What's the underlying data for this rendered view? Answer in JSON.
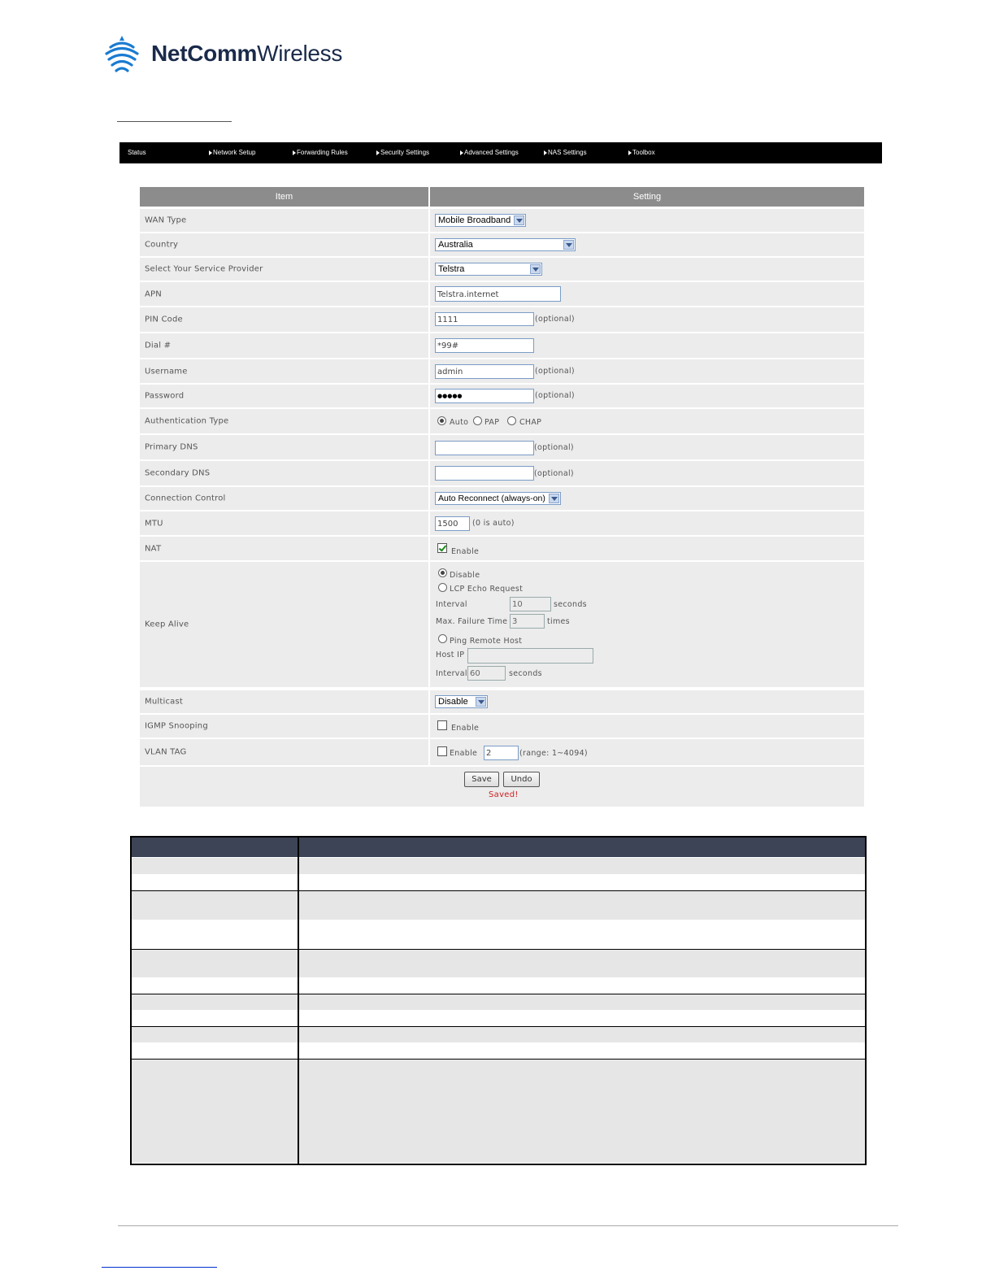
{
  "brand": {
    "name_bold": "NetComm",
    "name_light": "Wireless"
  },
  "nav": [
    {
      "label": "Status",
      "arrow": false
    },
    {
      "label": "Network Setup",
      "arrow": true
    },
    {
      "label": "Forwarding Rules",
      "arrow": true
    },
    {
      "label": "Security Settings",
      "arrow": true
    },
    {
      "label": "Advanced Settings",
      "arrow": true
    },
    {
      "label": "NAS Settings",
      "arrow": true
    },
    {
      "label": "Toolbox",
      "arrow": true
    }
  ],
  "table": {
    "header_item": "Item",
    "header_setting": "Setting",
    "wan_type": {
      "label": "WAN Type",
      "value": "Mobile Broadband"
    },
    "country": {
      "label": "Country",
      "value": "Australia"
    },
    "provider": {
      "label": "Select Your Service Provider",
      "value": "Telstra"
    },
    "apn": {
      "label": "APN",
      "value": "Telstra.internet"
    },
    "pin": {
      "label": "PIN Code",
      "value": "1111",
      "note": "(optional)"
    },
    "dial": {
      "label": "Dial #",
      "value": "*99#"
    },
    "username": {
      "label": "Username",
      "value": "admin",
      "note": "(optional)"
    },
    "password": {
      "label": "Password",
      "value": "●●●●●",
      "note": "(optional)"
    },
    "auth": {
      "label": "Authentication Type",
      "options": [
        "Auto",
        "PAP",
        "CHAP"
      ],
      "selected": "Auto"
    },
    "primary_dns": {
      "label": "Primary DNS",
      "value": "",
      "note": "(optional)"
    },
    "secondary_dns": {
      "label": "Secondary DNS",
      "value": "",
      "note": "(optional)"
    },
    "connection": {
      "label": "Connection Control",
      "value": "Auto Reconnect (always-on)"
    },
    "mtu": {
      "label": "MTU",
      "value": "1500",
      "note": "(0 is auto)"
    },
    "nat": {
      "label": "NAT",
      "checkbox_label": "Enable",
      "checked": true
    },
    "keep_alive": {
      "label": "Keep Alive",
      "disable": "Disable",
      "lcp": "LCP Echo Request",
      "interval_label": "Interval",
      "interval_value": "10",
      "interval_unit": "seconds",
      "max_fail_label": "Max. Failure Time",
      "max_fail_value": "3",
      "max_fail_unit": "times",
      "ping": "Ping Remote Host",
      "host_ip_label": "Host IP",
      "host_ip_value": "",
      "ping_interval_label": "Interval",
      "ping_interval_value": "60",
      "ping_interval_unit": "seconds",
      "selected": "Disable"
    },
    "multicast": {
      "label": "Multicast",
      "value": "Disable"
    },
    "igmp": {
      "label": "IGMP Snooping",
      "checkbox_label": "Enable",
      "checked": false
    },
    "vlan": {
      "label": "VLAN TAG",
      "checkbox_label": "Enable",
      "value": "2",
      "note": "(range: 1~4094)",
      "checked": false
    },
    "save_label": "Save",
    "undo_label": "Undo",
    "saved_msg": "Saved!"
  },
  "colors": {
    "nav_bg": "#000000",
    "header_bg": "#8c8c8c",
    "row_bg": "#ececec",
    "saved": "#d02020",
    "lower_header": "#3d4456"
  }
}
